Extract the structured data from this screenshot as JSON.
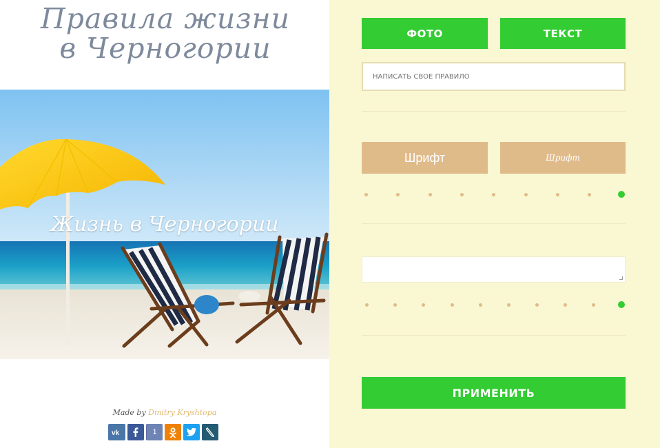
{
  "page": {
    "title": "Правила жизни в Черногории"
  },
  "preview": {
    "overlay_text": "Жизнь в Черногории"
  },
  "footer": {
    "made_by": "Made by",
    "author": "Dmitry Kryshtopa",
    "socials": [
      {
        "name": "vk",
        "label": "vk"
      },
      {
        "name": "facebook",
        "label": "f"
      },
      {
        "name": "facebook-count",
        "label": "1"
      },
      {
        "name": "odnoklassniki",
        "label": "ok"
      },
      {
        "name": "twitter",
        "label": "tw"
      },
      {
        "name": "livejournal",
        "label": "lj"
      }
    ]
  },
  "controls": {
    "photo_button": "ФОТО",
    "text_button": "ТЕКСТ",
    "rule_input_placeholder": "НАПИСАТЬ СВОЕ ПРАВИЛО",
    "font_button_1": "Шрифт",
    "font_button_2": "Шрифт",
    "slider_1": {
      "positions": 9,
      "selected": 9
    },
    "slider_2": {
      "positions": 10,
      "selected": 10
    },
    "apply_button": "ПРИМЕНИТЬ"
  },
  "colors": {
    "accent_green": "#33cc33",
    "font_button": "#e0bb8a",
    "panel_bg": "#f9f8d2",
    "title_gray": "#7e8a9c"
  }
}
